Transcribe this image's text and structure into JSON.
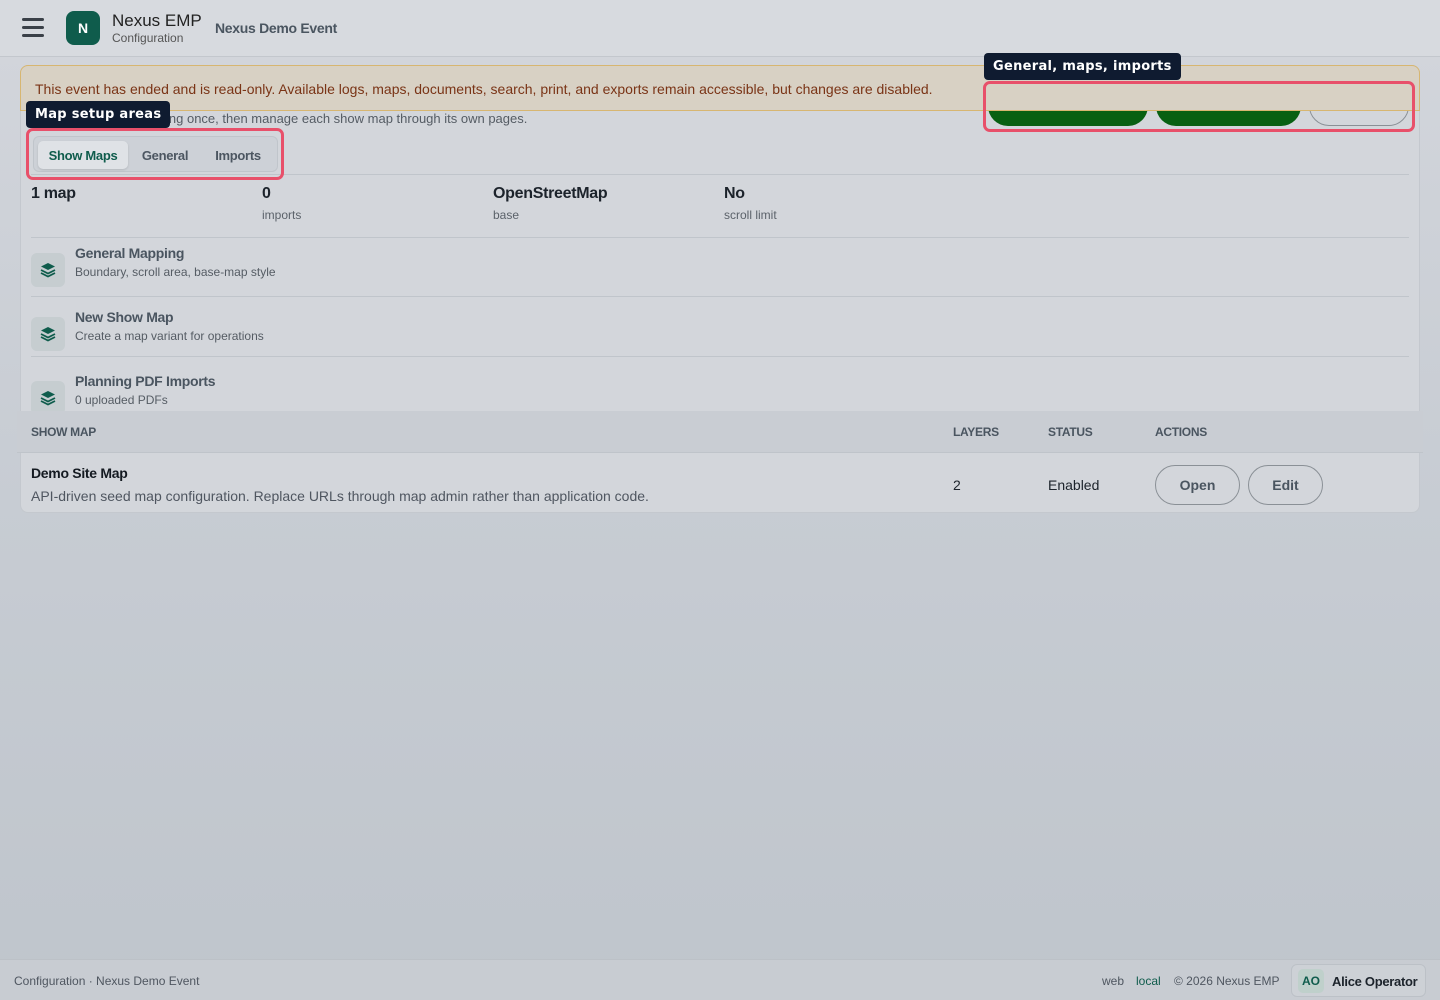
{
  "header": {
    "logo_letter": "N",
    "app_name": "Nexus EMP",
    "app_section": "Configuration",
    "event_name": "Nexus Demo Event"
  },
  "banner": {
    "text": "This event has ended and is read-only. Available logs, maps, documents, search, print, and exports remain accessible, but changes are disabled."
  },
  "intro": {
    "text": "ing once, then manage each show map through its own pages."
  },
  "tooltips": {
    "map_setup": "Map setup areas",
    "general_actions": "General, maps, imports"
  },
  "tabs": [
    {
      "label": "Show Maps",
      "active": true
    },
    {
      "label": "General",
      "active": false
    },
    {
      "label": "Imports",
      "active": false
    }
  ],
  "actions": {
    "general_label": "",
    "new_map_label": "",
    "imports_label": ""
  },
  "stats": [
    {
      "value": "1 map",
      "label": ""
    },
    {
      "value": "0",
      "label": "imports"
    },
    {
      "value": "OpenStreetMap",
      "label": "base"
    },
    {
      "value": "No",
      "label": "scroll limit"
    }
  ],
  "sections": [
    {
      "title": "General Mapping",
      "subtitle": "Boundary, scroll area, base-map style"
    },
    {
      "title": "New Show Map",
      "subtitle": "Create a map variant for operations"
    },
    {
      "title": "Planning PDF Imports",
      "subtitle": "0 uploaded PDFs"
    }
  ],
  "table": {
    "columns": [
      "SHOW MAP",
      "LAYERS",
      "STATUS",
      "ACTIONS"
    ],
    "rows": [
      {
        "name": "Demo Site Map",
        "description": "API-driven seed map configuration. Replace URLs through map admin rather than application code.",
        "layers": "2",
        "status": "Enabled",
        "open_label": "Open",
        "edit_label": "Edit"
      }
    ]
  },
  "footer": {
    "context": "Configuration · Nexus Demo Event",
    "channel": "web",
    "env": "local",
    "copyright": "© 2026 Nexus EMP",
    "user_initials": "AO",
    "user_name": "Alice Operator"
  },
  "colors": {
    "brand": "#0f5c4c",
    "action_green": "#086012",
    "highlight": "#e8506a",
    "warning_text": "#7a3416"
  }
}
